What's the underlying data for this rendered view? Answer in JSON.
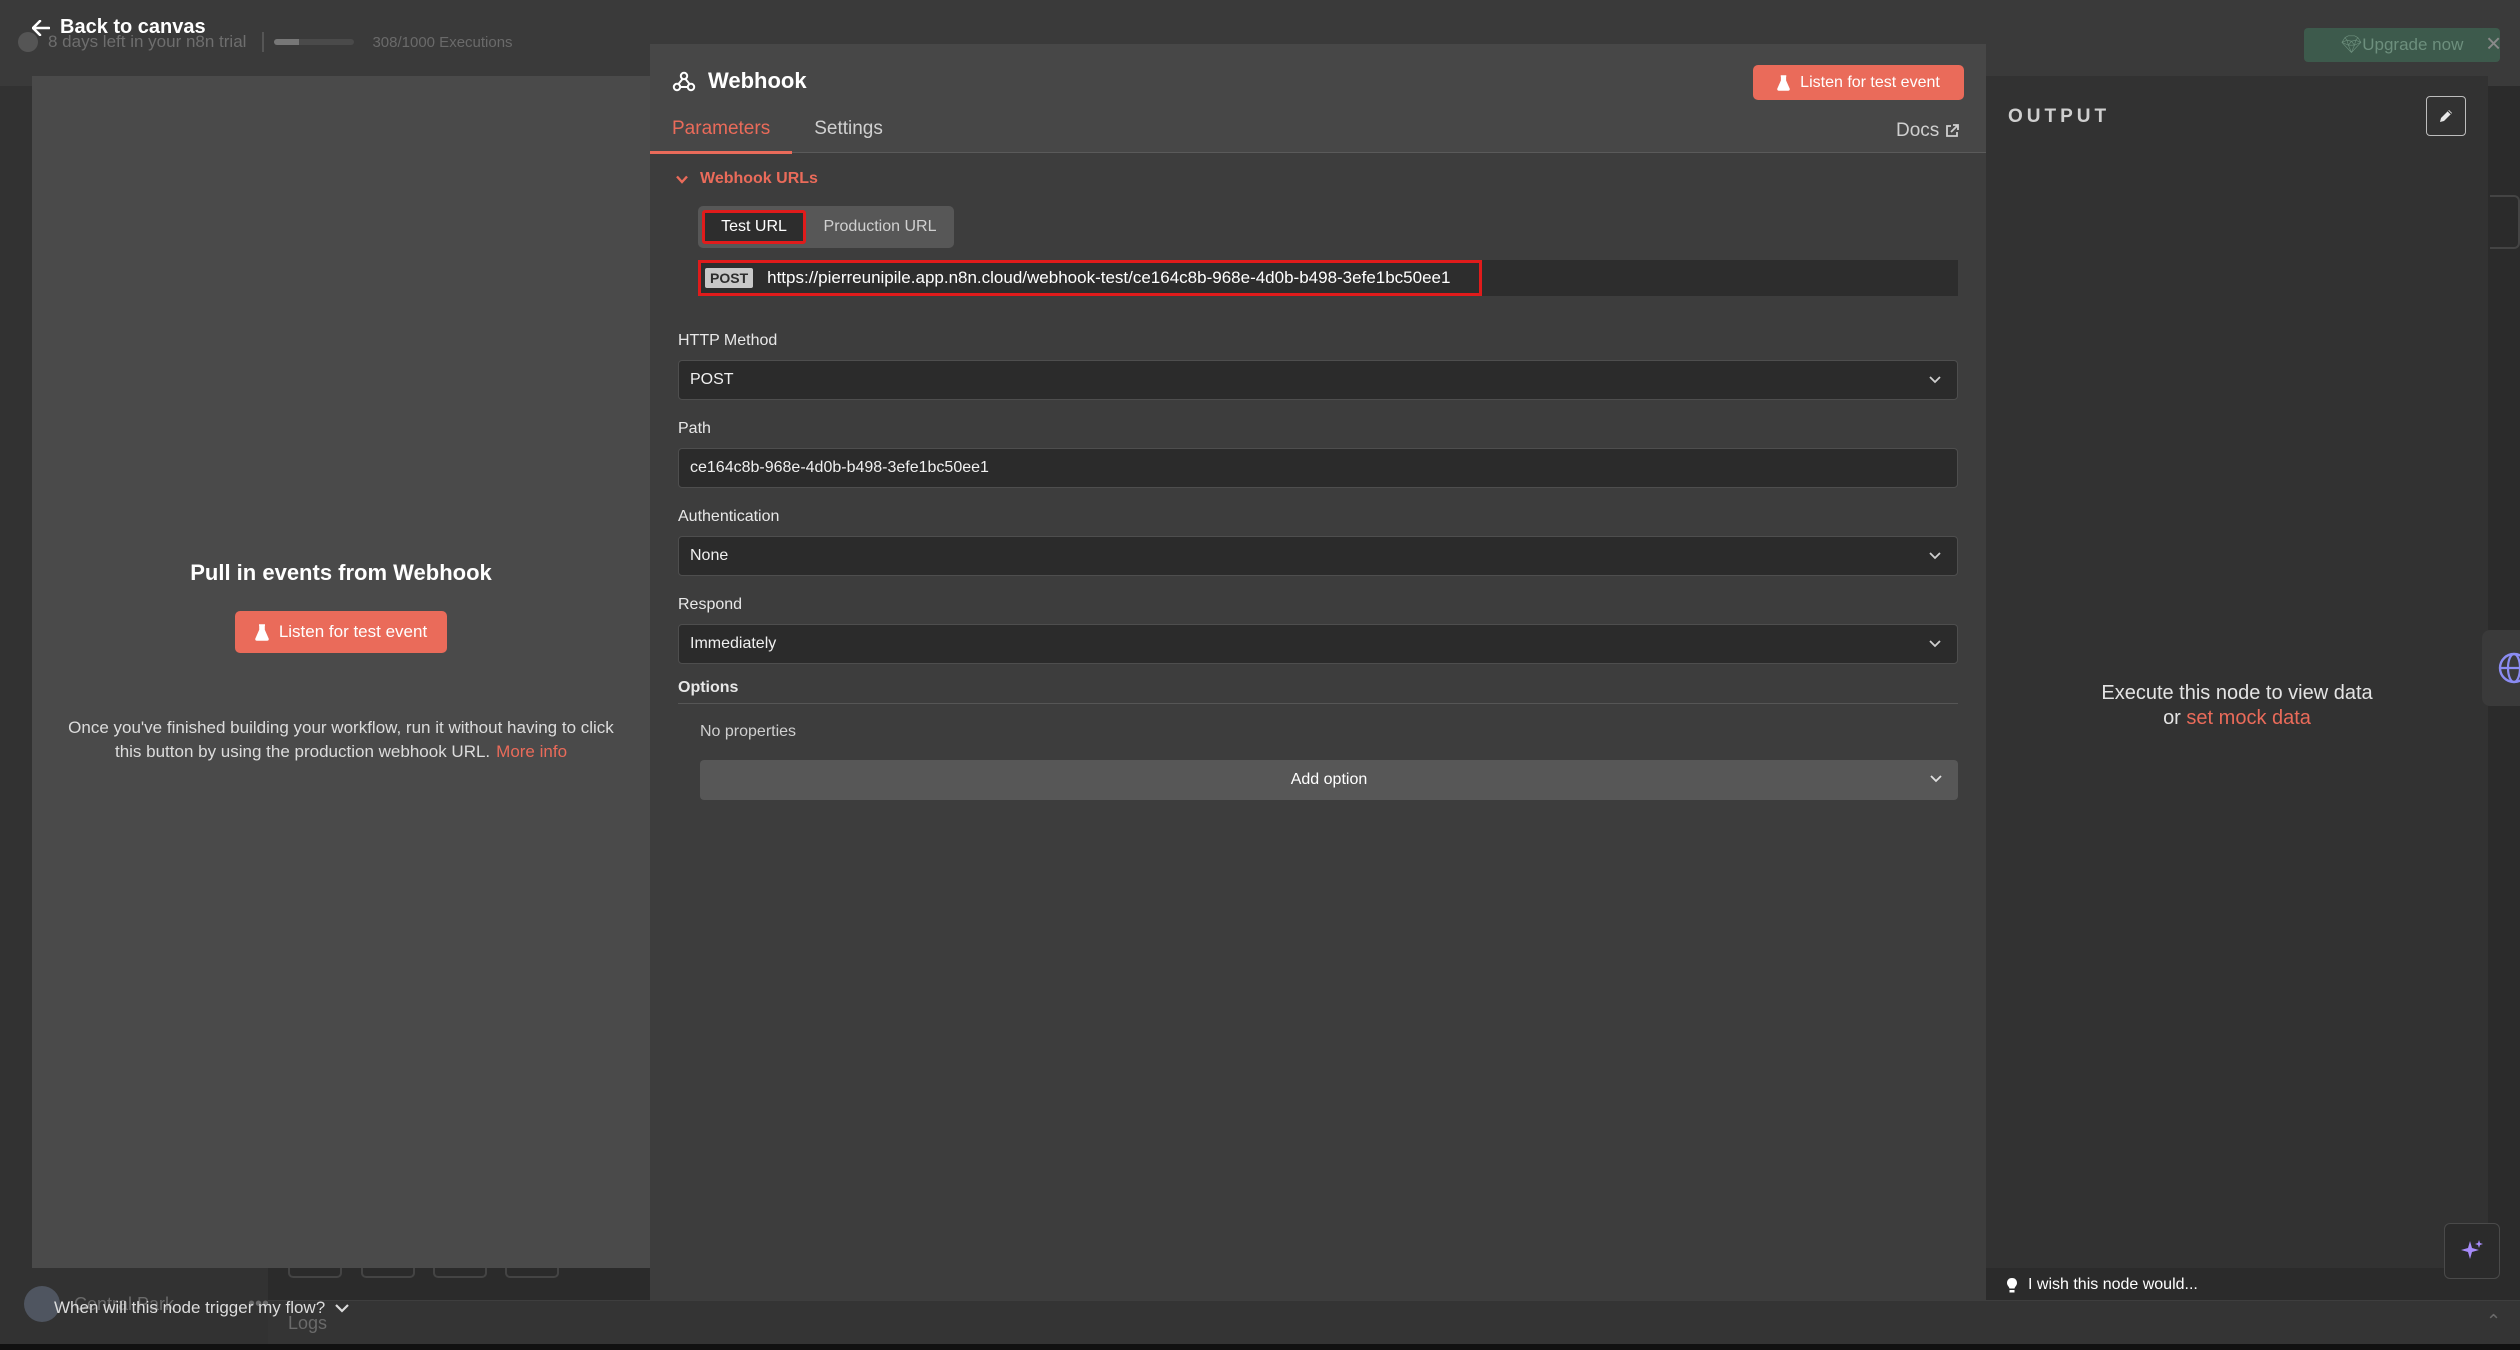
{
  "background": {
    "trial_text": "8 days left in your n8n trial",
    "executions_text": "308/1000 Executions",
    "executions_progress": 0.308,
    "upgrade_label": "Upgrade now",
    "user_name": "Central Park",
    "logs_label": "Logs"
  },
  "nav": {
    "back_label": "Back to canvas"
  },
  "input_panel": {
    "title": "Pull in events from Webhook",
    "listen_label": "Listen for test event",
    "description": "Once you've finished building your workflow, run it without having to click this button by using the production webhook URL.",
    "more_info_label": "More info",
    "trigger_question": "When will this node trigger my flow?"
  },
  "node": {
    "title": "Webhook",
    "listen_label": "Listen for test event",
    "tabs": [
      {
        "label": "Parameters",
        "active": true
      },
      {
        "label": "Settings",
        "active": false
      }
    ],
    "docs_label": "Docs",
    "webhook_urls": {
      "section_label": "Webhook URLs",
      "tabs": [
        {
          "label": "Test URL",
          "active": true
        },
        {
          "label": "Production URL",
          "active": false
        }
      ],
      "method_badge": "POST",
      "url": "https://pierreunipile.app.n8n.cloud/webhook-test/ce164c8b-968e-4d0b-b498-3efe1bc50ee1"
    },
    "fields": {
      "http_method": {
        "label": "HTTP Method",
        "value": "POST"
      },
      "path": {
        "label": "Path",
        "value": "ce164c8b-968e-4d0b-b498-3efe1bc50ee1"
      },
      "authentication": {
        "label": "Authentication",
        "value": "None"
      },
      "respond": {
        "label": "Respond",
        "value": "Immediately"
      }
    },
    "options": {
      "label": "Options",
      "empty_text": "No properties",
      "add_label": "Add option"
    }
  },
  "output_panel": {
    "title": "OUTPUT",
    "empty_line1": "Execute this node to view data",
    "empty_or": "or",
    "mock_link": "set mock data",
    "wish_text": "I wish this node would..."
  },
  "colors": {
    "accent": "#ea6b5a",
    "highlight_border": "#e01b1b",
    "panel_bg": "#3d3d3d"
  }
}
